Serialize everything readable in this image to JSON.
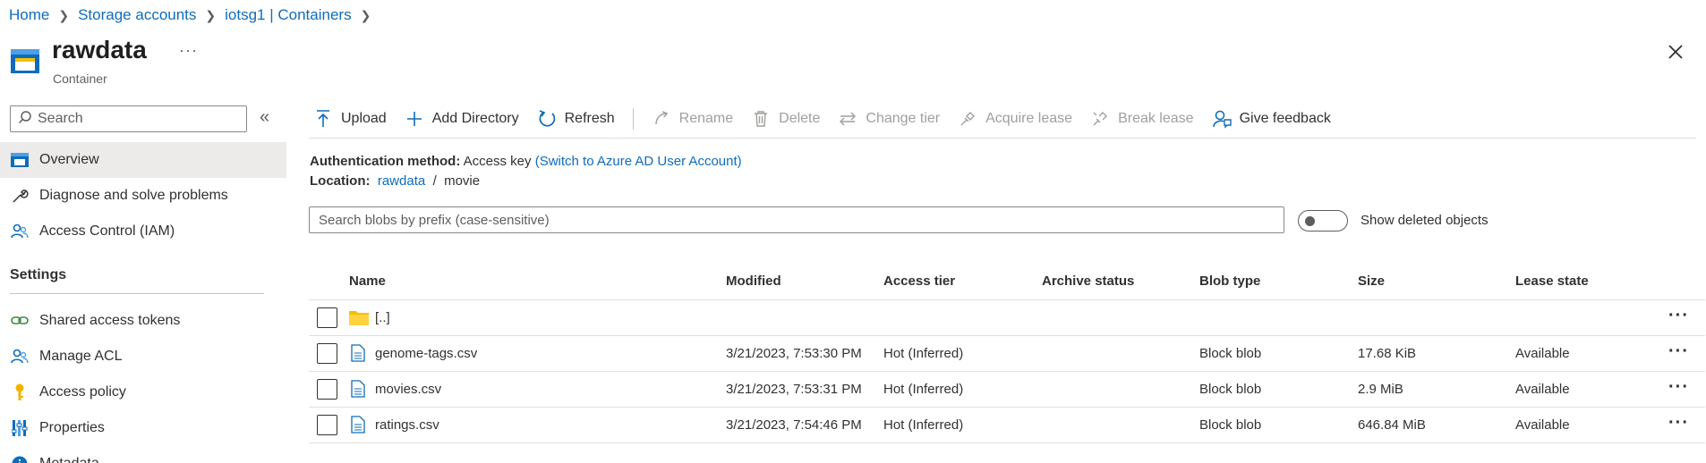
{
  "breadcrumb": [
    "Home",
    "Storage accounts",
    "iotsg1 | Containers"
  ],
  "header": {
    "title": "rawdata",
    "subtitle": "Container",
    "more": "···"
  },
  "sidebar": {
    "search_placeholder": "Search",
    "collapse": "«",
    "items": [
      {
        "label": "Overview",
        "icon": "container-icon"
      },
      {
        "label": "Diagnose and solve problems",
        "icon": "wrench-icon"
      },
      {
        "label": "Access Control (IAM)",
        "icon": "people-icon"
      }
    ],
    "section": "Settings",
    "settings_items": [
      {
        "label": "Shared access tokens",
        "icon": "link-icon"
      },
      {
        "label": "Manage ACL",
        "icon": "people-icon"
      },
      {
        "label": "Access policy",
        "icon": "key-icon"
      },
      {
        "label": "Properties",
        "icon": "properties-icon"
      },
      {
        "label": "Metadata",
        "icon": "info-icon"
      }
    ]
  },
  "toolbar": {
    "upload": "Upload",
    "add_directory": "Add Directory",
    "refresh": "Refresh",
    "rename": "Rename",
    "delete": "Delete",
    "change_tier": "Change tier",
    "acquire_lease": "Acquire lease",
    "break_lease": "Break lease",
    "give_feedback": "Give feedback"
  },
  "auth": {
    "label": "Authentication method:",
    "value": "Access key",
    "switch_link": "(Switch to Azure AD User Account)"
  },
  "location": {
    "label": "Location:",
    "root_link": "rawdata",
    "sep": "/",
    "folder": "movie"
  },
  "blob_search": {
    "placeholder": "Search blobs by prefix (case-sensitive)"
  },
  "show_deleted": {
    "label": "Show deleted objects",
    "on": false
  },
  "table": {
    "headers": [
      "Name",
      "Modified",
      "Access tier",
      "Archive status",
      "Blob type",
      "Size",
      "Lease state"
    ],
    "parent_row": "[..]",
    "rows": [
      {
        "name": "genome-tags.csv",
        "modified": "3/21/2023, 7:53:30 PM",
        "tier": "Hot (Inferred)",
        "archive": "",
        "type": "Block blob",
        "size": "17.68 KiB",
        "lease": "Available"
      },
      {
        "name": "movies.csv",
        "modified": "3/21/2023, 7:53:31 PM",
        "tier": "Hot (Inferred)",
        "archive": "",
        "type": "Block blob",
        "size": "2.9 MiB",
        "lease": "Available"
      },
      {
        "name": "ratings.csv",
        "modified": "3/21/2023, 7:54:46 PM",
        "tier": "Hot (Inferred)",
        "archive": "",
        "type": "Block blob",
        "size": "646.84 MiB",
        "lease": "Available"
      }
    ],
    "row_menu": "···"
  },
  "colors": {
    "link": "#0f6cbd",
    "folder": "#f5c000",
    "key": "#f0b400",
    "icon_blue": "#0f6cbd"
  }
}
